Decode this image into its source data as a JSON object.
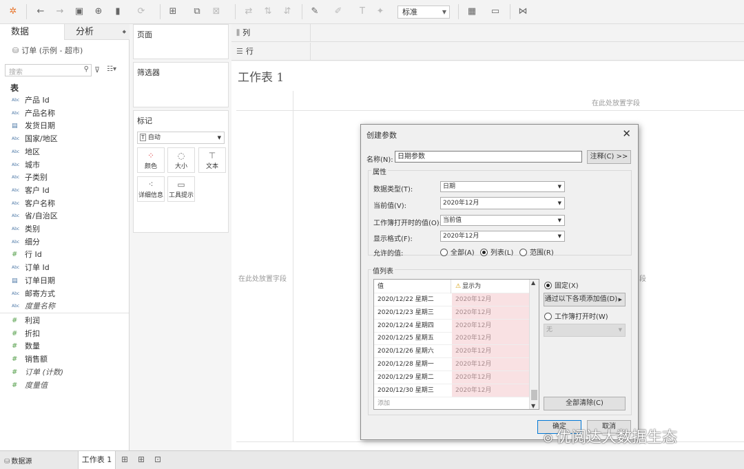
{
  "toolbar": {
    "fit_value": "标准",
    "icons": [
      "tableau-logo-icon",
      "undo-icon",
      "redo-icon",
      "save-icon",
      "new-datasource-icon",
      "pause-updates-icon",
      "refresh-icon",
      "new-worksheet-icon",
      "duplicate-icon",
      "clear-icon",
      "swap-icon",
      "sort-asc-icon",
      "sort-desc-icon",
      "highlight-icon",
      "group-icon",
      "label-icon",
      "fix-axes-icon",
      "show-me-icon",
      "presentation-icon",
      "share-icon"
    ]
  },
  "left": {
    "tab_data": "数据",
    "tab_analysis": "分析",
    "datasource": "订单 (示例 - 超市)",
    "search_placeholder": "搜索",
    "table_header": "表",
    "dimensions": [
      {
        "type": "Abc",
        "name": "产品 Id"
      },
      {
        "type": "Abc",
        "name": "产品名称"
      },
      {
        "type": "date",
        "name": "发货日期"
      },
      {
        "type": "Abc",
        "name": "国家/地区"
      },
      {
        "type": "Abc",
        "name": "地区"
      },
      {
        "type": "Abc",
        "name": "城市"
      },
      {
        "type": "Abc",
        "name": "子类别"
      },
      {
        "type": "Abc",
        "name": "客户 Id"
      },
      {
        "type": "Abc",
        "name": "客户名称"
      },
      {
        "type": "Abc",
        "name": "省/自治区"
      },
      {
        "type": "Abc",
        "name": "类别"
      },
      {
        "type": "Abc",
        "name": "细分"
      },
      {
        "type": "#",
        "name": "行 Id"
      },
      {
        "type": "Abc",
        "name": "订单 Id"
      },
      {
        "type": "date",
        "name": "订单日期"
      },
      {
        "type": "Abc",
        "name": "邮寄方式"
      },
      {
        "type": "Abc",
        "name": "度量名称",
        "italic": true
      }
    ],
    "measures": [
      {
        "type": "#",
        "name": "利润"
      },
      {
        "type": "#",
        "name": "折扣"
      },
      {
        "type": "#",
        "name": "数量"
      },
      {
        "type": "#",
        "name": "销售额"
      },
      {
        "type": "#",
        "name": "订单 (计数)",
        "italic": true
      },
      {
        "type": "#",
        "name": "度量值",
        "italic": true
      }
    ]
  },
  "shelves": {
    "pages": "页面",
    "filters": "筛选器",
    "marks": "标记",
    "mark_type": "自动",
    "mark_buttons": [
      "颜色",
      "大小",
      "文本",
      "详细信息",
      "工具提示"
    ],
    "columns": "列",
    "rows": "行"
  },
  "worksheet": {
    "title": "工作表 1",
    "drop_hint": "在此处放置字段",
    "drop_hint_right": "段"
  },
  "statusbar": {
    "datasource": "数据源",
    "sheet_tab": "工作表 1"
  },
  "dialog": {
    "title": "创建参数",
    "name_label": "名称(N):",
    "name_value": "日期参数",
    "comment_button": "注释(C) >>",
    "properties_label": "属性",
    "datatype_label": "数据类型(T):",
    "datatype_value": "日期",
    "current_label": "当前值(V):",
    "current_value": "2020年12月",
    "workbook_open_label": "工作簿打开时的值(O):",
    "workbook_open_value": "当前值",
    "format_label": "显示格式(F):",
    "format_value": "2020年12月",
    "allowed_label": "允许的值:",
    "allowed_all": "全部(A)",
    "allowed_list": "列表(L)",
    "allowed_range": "范围(R)",
    "value_list_label": "值列表",
    "col_value": "值",
    "col_display": "显示为",
    "rows": [
      {
        "value": "2020/12/22 星期二",
        "display": "2020年12月"
      },
      {
        "value": "2020/12/23 星期三",
        "display": "2020年12月"
      },
      {
        "value": "2020/12/24 星期四",
        "display": "2020年12月"
      },
      {
        "value": "2020/12/25 星期五",
        "display": "2020年12月"
      },
      {
        "value": "2020/12/26 星期六",
        "display": "2020年12月"
      },
      {
        "value": "2020/12/28 星期一",
        "display": "2020年12月"
      },
      {
        "value": "2020/12/29 星期二",
        "display": "2020年12月"
      },
      {
        "value": "2020/12/30 星期三",
        "display": "2020年12月"
      }
    ],
    "add_placeholder": "添加",
    "fixed_label": "固定(X)",
    "add_from_button": "通过以下各项添加值(D)",
    "when_open_label": "工作簿打开时(W)",
    "when_open_value": "无",
    "clear_all": "全部清除(C)",
    "ok": "确定",
    "cancel": "取消"
  },
  "watermark": "优阅达大数据生态"
}
